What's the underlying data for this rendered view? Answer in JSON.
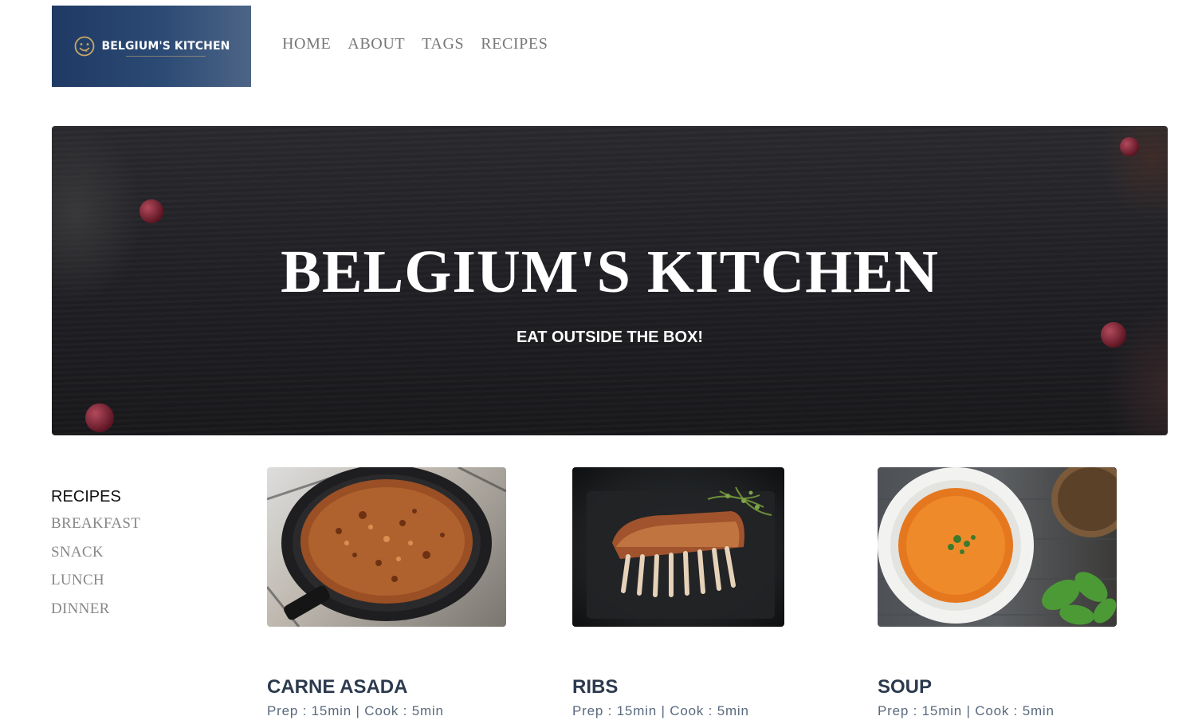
{
  "brand": {
    "logo_text": "BELGIUM'S KITCHEN"
  },
  "nav": [
    {
      "label": "HOME"
    },
    {
      "label": "ABOUT"
    },
    {
      "label": "TAGS"
    },
    {
      "label": "RECIPES"
    }
  ],
  "hero": {
    "title": "BELGIUM'S KITCHEN",
    "subtitle": "EAT OUTSIDE THE BOX!"
  },
  "sidebar": {
    "title": "RECIPES",
    "items": [
      {
        "label": "BREAKFAST"
      },
      {
        "label": "SNACK"
      },
      {
        "label": "LUNCH"
      },
      {
        "label": "DINNER"
      }
    ]
  },
  "recipes": [
    {
      "name": "CARNE ASADA",
      "meta": "Prep : 15min | Cook : 5min",
      "image": "carne-asada-pan-photo"
    },
    {
      "name": "RIBS",
      "meta": "Prep : 15min | Cook : 5min",
      "image": "ribs-rack-photo"
    },
    {
      "name": "SOUP",
      "meta": "Prep : 15min | Cook : 5min",
      "image": "tomato-soup-bowl-photo"
    }
  ],
  "colors": {
    "logo_bg": "#1f3a64",
    "hero_bg": "#1f1f23",
    "nav_text": "#777777",
    "recipe_title": "#2c3a4e",
    "recipe_meta": "#5a6a7e"
  }
}
